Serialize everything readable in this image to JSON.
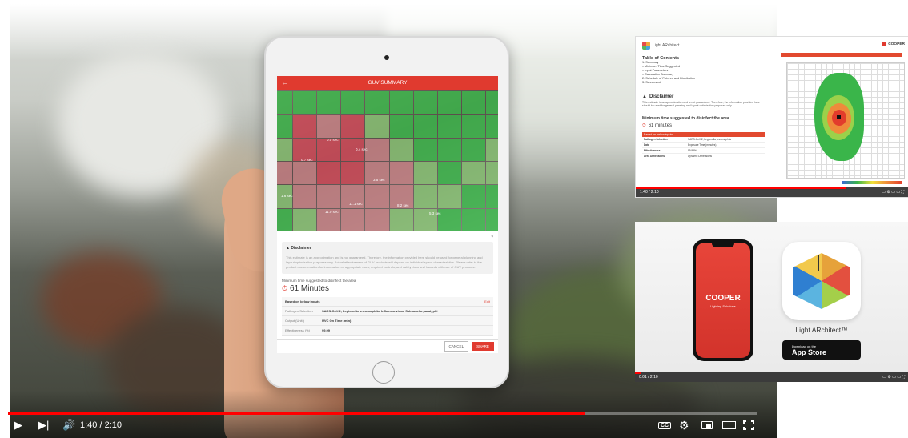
{
  "player": {
    "time_current": "1:40",
    "time_total": "2:10",
    "time_display": "1:40 / 2:10",
    "progress": 0.77,
    "cc_label": "CC"
  },
  "tablet_app": {
    "header_title": "GUV SUMMARY",
    "ar_labels": [
      "0.0 sec",
      "0.7 sec",
      "0.4 sec",
      "3.5 sec",
      "1.6 sec",
      "11.0 sec",
      "11.1 sec",
      "8.2 sec",
      "5.3 sec"
    ],
    "disclaimer_title": "Disclaimer",
    "disclaimer_text": "This estimate is an approximation and is not guaranteed. Therefore, the information provided here should be used for general planning and layout optimization purposes only. Actual effectiveness of GUV products will depend on individual space characteristics. Please refer to the product documentation for information on appropriate uses, required controls, and safety risks and hazards with use of GUV products.",
    "min_time_label": "Minimum time suggested to disinfect the area",
    "min_time_value": "61 Minutes",
    "based_on_label": "Based on below inputs",
    "edit_label": "Edit",
    "rows": [
      {
        "key": "Pathogen Selection",
        "value": "SARS-CoV-2, Legionella pneumophila, Influenza virus, Salmonella paratyphi"
      },
      {
        "key": "Output (UnitI)",
        "value": "UVC On Time (min)"
      },
      {
        "key": "Effectiveness (%)",
        "value": "99.99"
      }
    ],
    "cancel_label": "CANCEL",
    "share_label": "SHARE"
  },
  "thumb_report": {
    "brand": "Light ARchitect",
    "toc_title": "Table of Contents",
    "toc_items": [
      "1. Summary",
      "– Minimum Time Suggested",
      "– Input Parameters",
      "– Calculation Summary",
      "2. Schedule of Fixtures and Distribution",
      "3. Screenshot"
    ],
    "disclaimer_title": "Disclaimer",
    "disclaimer_text": "This estimate is an approximation and is not guaranteed. Therefore, the information provided here should be used for general planning and layout optimization purposes only.",
    "min_time_title": "Minimum time suggested to disinfect the area",
    "min_time_value": "61 minutes",
    "table_head": "Based on below inputs",
    "table_rows": [
      {
        "k": "Pathogen Selection",
        "v": "SARS-CoV-2, Legionella pneumophila"
      },
      {
        "k": "Data",
        "v": "Exposure Time (minutes)"
      },
      {
        "k": "Effectiveness",
        "v": "99.99%"
      },
      {
        "k": "Area Dimensions",
        "v": "Dynamic Dimensions"
      }
    ],
    "cooper_brand": "COOPER",
    "time_display": "1:40 / 2:10"
  },
  "thumb_app": {
    "phone_brand": "COOPER",
    "phone_sub": "Lighting Solutions",
    "app_name": "Light ARchitect™",
    "store_small": "Download on the",
    "store_big": "App Store",
    "time_display": "0:01 / 2:10"
  }
}
